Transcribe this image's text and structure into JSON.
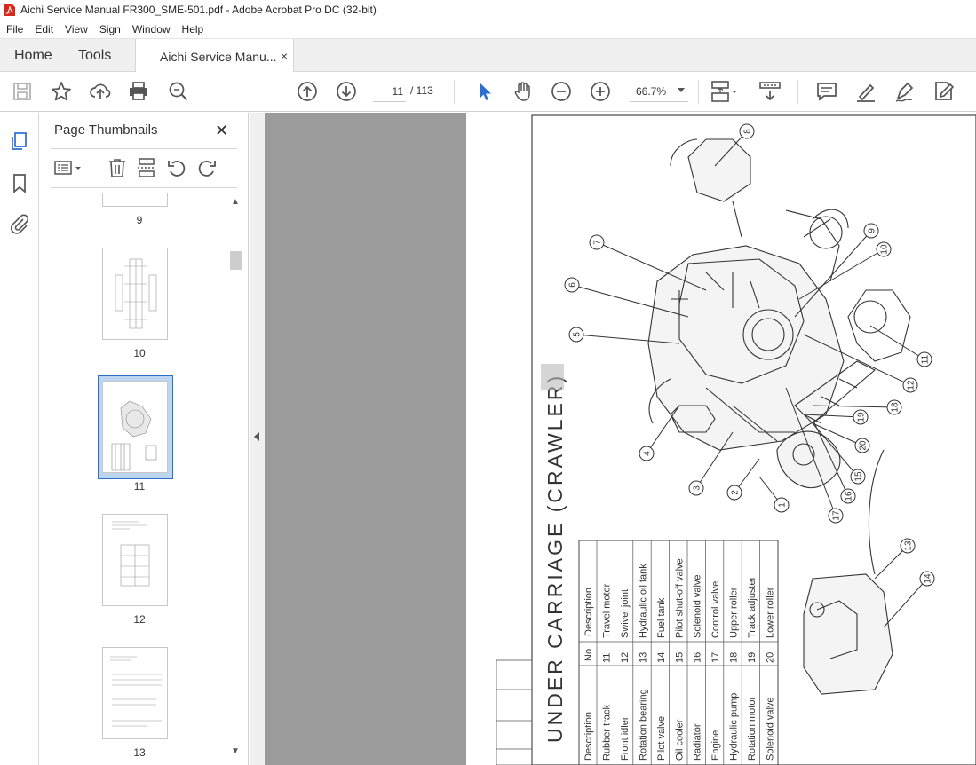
{
  "window": {
    "title": "Aichi Service Manual FR300_SME-501.pdf - Adobe Acrobat Pro DC (32-bit)"
  },
  "menu": [
    "File",
    "Edit",
    "View",
    "Sign",
    "Window",
    "Help"
  ],
  "tabs": {
    "home": "Home",
    "tools": "Tools",
    "document": "Aichi Service Manu...",
    "close": "×"
  },
  "toolbar": {
    "current_page": "11",
    "page_separator": "/ 113",
    "zoom": "66.7%"
  },
  "panel": {
    "title": "Page Thumbnails",
    "close": "✕",
    "thumbnails": [
      {
        "label": "9"
      },
      {
        "label": "10"
      },
      {
        "label": "11",
        "selected": true
      },
      {
        "label": "12"
      },
      {
        "label": "13"
      }
    ]
  },
  "document": {
    "heading": "UNDER CARRIAGE (CRAWLER)",
    "callouts": [
      "1",
      "2",
      "3",
      "4",
      "5",
      "6",
      "7",
      "8",
      "9",
      "10",
      "11",
      "12",
      "13",
      "14",
      "15",
      "16",
      "17",
      "18",
      "19",
      "20"
    ],
    "table": {
      "headers": [
        "Description",
        "No",
        "Description"
      ],
      "left_descriptions": [
        "Rubber track",
        "Front idler",
        "Rotation bearing",
        "Pilot valve",
        "Oil cooler",
        "Radiator",
        "Engine",
        "Hydraulic pump",
        "Rotation motor",
        "Solenoid valve"
      ],
      "numbers": [
        "11",
        "12",
        "13",
        "14",
        "15",
        "16",
        "17",
        "18",
        "19",
        "20"
      ],
      "right_descriptions": [
        "Travel motor",
        "Swivel joint",
        "Hydraulic oil tank",
        "Fuel tank",
        "Pilot shut-off valve",
        "Solenoid valve",
        "Control valve",
        "Upper roller",
        "Track adjuster",
        "Lower roller"
      ]
    }
  }
}
